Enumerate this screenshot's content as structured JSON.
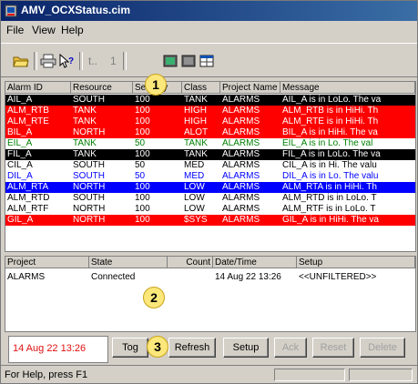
{
  "window": {
    "title": "AMV_OCXStatus.cim"
  },
  "menu": [
    {
      "label": "File"
    },
    {
      "label": "View"
    },
    {
      "label": "Help"
    }
  ],
  "toolbar": {
    "sep_text": "t..",
    "page_num": "1"
  },
  "alarms": {
    "columns": [
      "Alarm ID",
      "Resource",
      "Severity",
      "Class",
      "Project Name",
      "Message"
    ],
    "rows": [
      {
        "cells": [
          "AIL_A",
          "SOUTH",
          "100",
          "TANK",
          "ALARMS",
          "AIL_A is in  LoLo. The va"
        ],
        "bg": "#000000",
        "fg": "#ffffff"
      },
      {
        "cells": [
          "ALM_RTB",
          "TANK",
          "100",
          "HIGH",
          "ALARMS",
          "ALM_RTB is in  HiHi. Th"
        ],
        "bg": "#ff0000",
        "fg": "#ffffff"
      },
      {
        "cells": [
          "ALM_RTE",
          "TANK",
          "100",
          "HIGH",
          "ALARMS",
          "ALM_RTE is in  HiHi. Th"
        ],
        "bg": "#ff0000",
        "fg": "#ffffff"
      },
      {
        "cells": [
          "BIL_A",
          "NORTH",
          "100",
          "ALOT",
          "ALARMS",
          "BIL_A is in  HiHi. The va"
        ],
        "bg": "#ff0000",
        "fg": "#ffffff"
      },
      {
        "cells": [
          "EIL_A",
          "TANK",
          "50",
          "TANK",
          "ALARMS",
          "EIL_A is in  Lo. The val"
        ],
        "bg": "#ffffff",
        "fg": "#008000"
      },
      {
        "cells": [
          "FIL_A",
          "TANK",
          "100",
          "TANK",
          "ALARMS",
          "FIL_A is in  LoLo. The va"
        ],
        "bg": "#000000",
        "fg": "#ffffff"
      },
      {
        "cells": [
          "CIL_A",
          "SOUTH",
          "50",
          "MED",
          "ALARMS",
          "CIL_A is in  Hi. The valu"
        ],
        "bg": "#ffffff",
        "fg": "#000000"
      },
      {
        "cells": [
          "DIL_A",
          "SOUTH",
          "50",
          "MED",
          "ALARMS",
          "DIL_A is in  Lo. The valu"
        ],
        "bg": "#ffffff",
        "fg": "#0000ff"
      },
      {
        "cells": [
          "ALM_RTA",
          "NORTH",
          "100",
          "LOW",
          "ALARMS",
          "ALM_RTA is in  HiHi. Th"
        ],
        "bg": "#0000ff",
        "fg": "#ffffff"
      },
      {
        "cells": [
          "ALM_RTD",
          "SOUTH",
          "100",
          "LOW",
          "ALARMS",
          "ALM_RTD is in  LoLo. T"
        ],
        "bg": "#ffffff",
        "fg": "#000000"
      },
      {
        "cells": [
          "ALM_RTF",
          "NORTH",
          "100",
          "LOW",
          "ALARMS",
          "ALM_RTF is in  LoLo. T"
        ],
        "bg": "#ffffff",
        "fg": "#000000"
      },
      {
        "cells": [
          "GIL_A",
          "NORTH",
          "100",
          "$SYS",
          "ALARMS",
          "GIL_A is in  HiHi. The va"
        ],
        "bg": "#ff0000",
        "fg": "#ffffff"
      }
    ]
  },
  "connections": {
    "columns": [
      "Project",
      "State",
      "Count",
      "Date/Time",
      "Setup"
    ],
    "rows": [
      {
        "cells": [
          "ALARMS",
          "Connected",
          "",
          "14 Aug 22 13:26",
          "<<UNFILTERED>>"
        ]
      }
    ]
  },
  "footer": {
    "timestamp": "14 Aug 22 13:26",
    "buttons": [
      {
        "label": "Tog",
        "enabled": true
      },
      {
        "label": "Refresh",
        "enabled": true
      },
      {
        "label": "Setup",
        "enabled": true
      },
      {
        "label": "Ack",
        "enabled": false
      },
      {
        "label": "Reset",
        "enabled": false
      },
      {
        "label": "Delete",
        "enabled": false
      }
    ]
  },
  "status": {
    "text": "For Help, press F1"
  },
  "callouts": [
    "1",
    "2",
    "3"
  ],
  "colors": {
    "title_start": "#0a246a",
    "title_end": "#3a6ea5",
    "callout": "#fbe77a",
    "timestamp": "#e01010"
  }
}
